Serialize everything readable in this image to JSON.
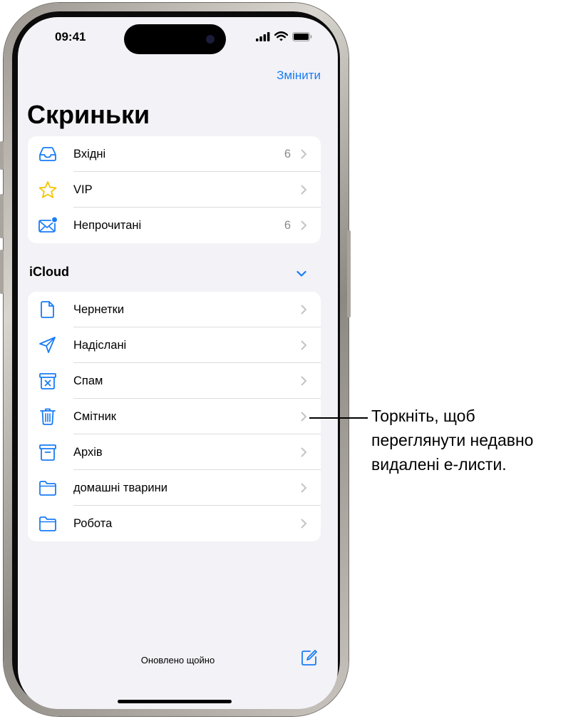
{
  "status_bar": {
    "time": "09:41"
  },
  "nav": {
    "edit_label": "Змінити",
    "title": "Скриньки"
  },
  "colors": {
    "accent": "#1a7cf5",
    "vip_star": "#f5c400",
    "unread_dot": "#1a7cf5",
    "background": "#f2f2f7"
  },
  "smart_mailboxes": [
    {
      "label": "Вхідні",
      "count": "6",
      "icon": "inbox-tray-icon"
    },
    {
      "label": "VIP",
      "count": "",
      "icon": "star-icon"
    },
    {
      "label": "Непрочитані",
      "count": "6",
      "icon": "unread-envelope-icon"
    }
  ],
  "icloud": {
    "title": "iCloud",
    "mailboxes": [
      {
        "label": "Чернетки",
        "icon": "document-icon"
      },
      {
        "label": "Надіслані",
        "icon": "paper-plane-icon"
      },
      {
        "label": "Спам",
        "icon": "junk-box-icon"
      },
      {
        "label": "Смітник",
        "icon": "trash-icon"
      },
      {
        "label": "Архів",
        "icon": "archive-box-icon"
      },
      {
        "label": "домашні тварини",
        "icon": "folder-icon"
      },
      {
        "label": "Робота",
        "icon": "folder-icon"
      }
    ]
  },
  "footer": {
    "status_text": "Оновлено щойно",
    "compose_icon": "compose-icon"
  },
  "callout": {
    "lines": [
      "Торкніть, щоб",
      "переглянути недавно",
      "видалені е-листи."
    ]
  }
}
